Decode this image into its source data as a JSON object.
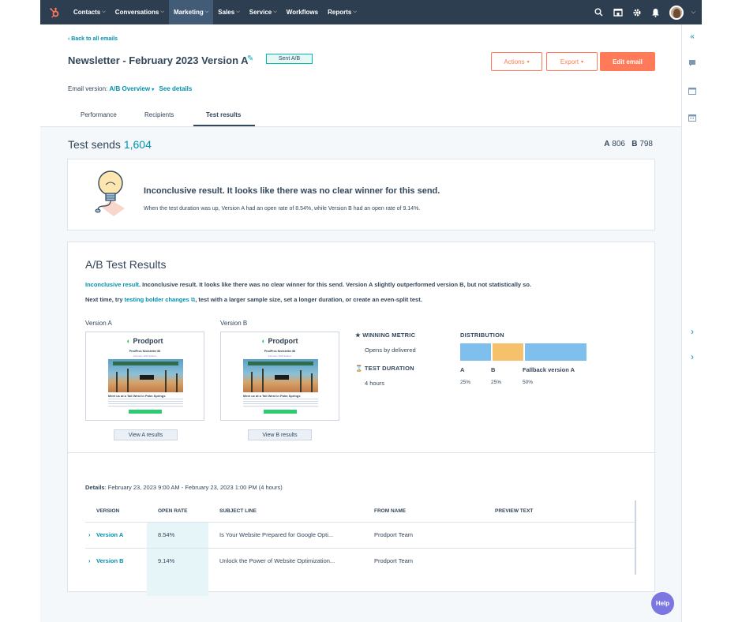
{
  "nav": {
    "items": [
      {
        "label": "Contacts",
        "caret": true
      },
      {
        "label": "Conversations",
        "caret": true
      },
      {
        "label": "Marketing",
        "caret": true,
        "active": true
      },
      {
        "label": "Sales",
        "caret": true
      },
      {
        "label": "Service",
        "caret": true
      },
      {
        "label": "Workflows",
        "caret": false
      },
      {
        "label": "Reports",
        "caret": true
      }
    ],
    "right_icons": [
      "search-icon",
      "marketplace-icon",
      "gear-icon",
      "bell-icon"
    ],
    "brand_color": "#ff7a59",
    "bar_color": "#2d3e50"
  },
  "header": {
    "back_link": "‹ Back to all emails",
    "title": "Newsletter - February 2023 Version A",
    "status_badge": "Sent A/B",
    "actions_label": "Actions",
    "export_label": "Export",
    "edit_label": "Edit email",
    "email_version_prefix": "Email version:",
    "email_version_value": "A/B Overview",
    "see_details": "See details"
  },
  "tabs": [
    {
      "label": "Performance",
      "active": false
    },
    {
      "label": "Recipients",
      "active": false
    },
    {
      "label": "Test results",
      "active": true
    }
  ],
  "test_sends": {
    "label": "Test sends",
    "count": "1,604",
    "a_label": "A",
    "a_count": "806",
    "b_label": "B",
    "b_count": "798"
  },
  "inconclusive": {
    "title": "Inconclusive result. It looks like there was no clear winner for this send.",
    "description": "When the test duration was up, Version A had an open rate of 8.54%, while Version B had an open rate of 9.14%."
  },
  "ab_results": {
    "title": "A/B Test Results",
    "line1_link": "Inconclusive result",
    "line1_text": ". Inconclusive result. It looks like there was no clear winner for this send. Version A slightly outperformed version B, but not statistically so.",
    "line2_prefix": "Next time, try",
    "line2_link": "testing bolder changes",
    "line2_suffix": ", test with a larger sample size, set a longer duration, or create an even-split test.",
    "version_a_label": "Version A",
    "version_b_label": "Version B",
    "preview_brand": "Prodport",
    "preview_sub1": "ProdPros Newsletter 86",
    "preview_sub2": "February 2023 Edition",
    "preview_caption": "Meet us at a Tall West in Palm Springs",
    "view_a": "View A results",
    "view_b": "View B results",
    "winning_metric_label": "WINNING METRIC",
    "winning_metric_value": "Opens by delivered",
    "test_duration_label": "TEST DURATION",
    "test_duration_value": "4 hours",
    "distribution_label": "DISTRIBUTION",
    "distribution": [
      {
        "label": "A",
        "percent": "25%",
        "fraction": 0.25,
        "color": "#7fbfee"
      },
      {
        "label": "B",
        "percent": "25%",
        "fraction": 0.25,
        "color": "#f5c26b"
      },
      {
        "label": "Fallback version A",
        "percent": "50%",
        "fraction": 0.5,
        "color": "#7fbfee"
      }
    ]
  },
  "details": {
    "label": "Details",
    "value": "February 23, 2023 9:00 AM - February 23, 2023 1:00 PM (4 hours)"
  },
  "table": {
    "headers": [
      "VERSION",
      "OPEN RATE",
      "SUBJECT LINE",
      "FROM NAME",
      "PREVIEW TEXT"
    ],
    "rows": [
      {
        "version": "Version A",
        "open_rate": "8.54%",
        "subject": "Is Your Website Prepared for Google Opti...",
        "from": "Prodport Team",
        "preview": ""
      },
      {
        "version": "Version B",
        "open_rate": "9.14%",
        "subject": "Unlock the Power of Website Optimization...",
        "from": "Prodport Team",
        "preview": ""
      }
    ]
  },
  "help_label": "Help"
}
